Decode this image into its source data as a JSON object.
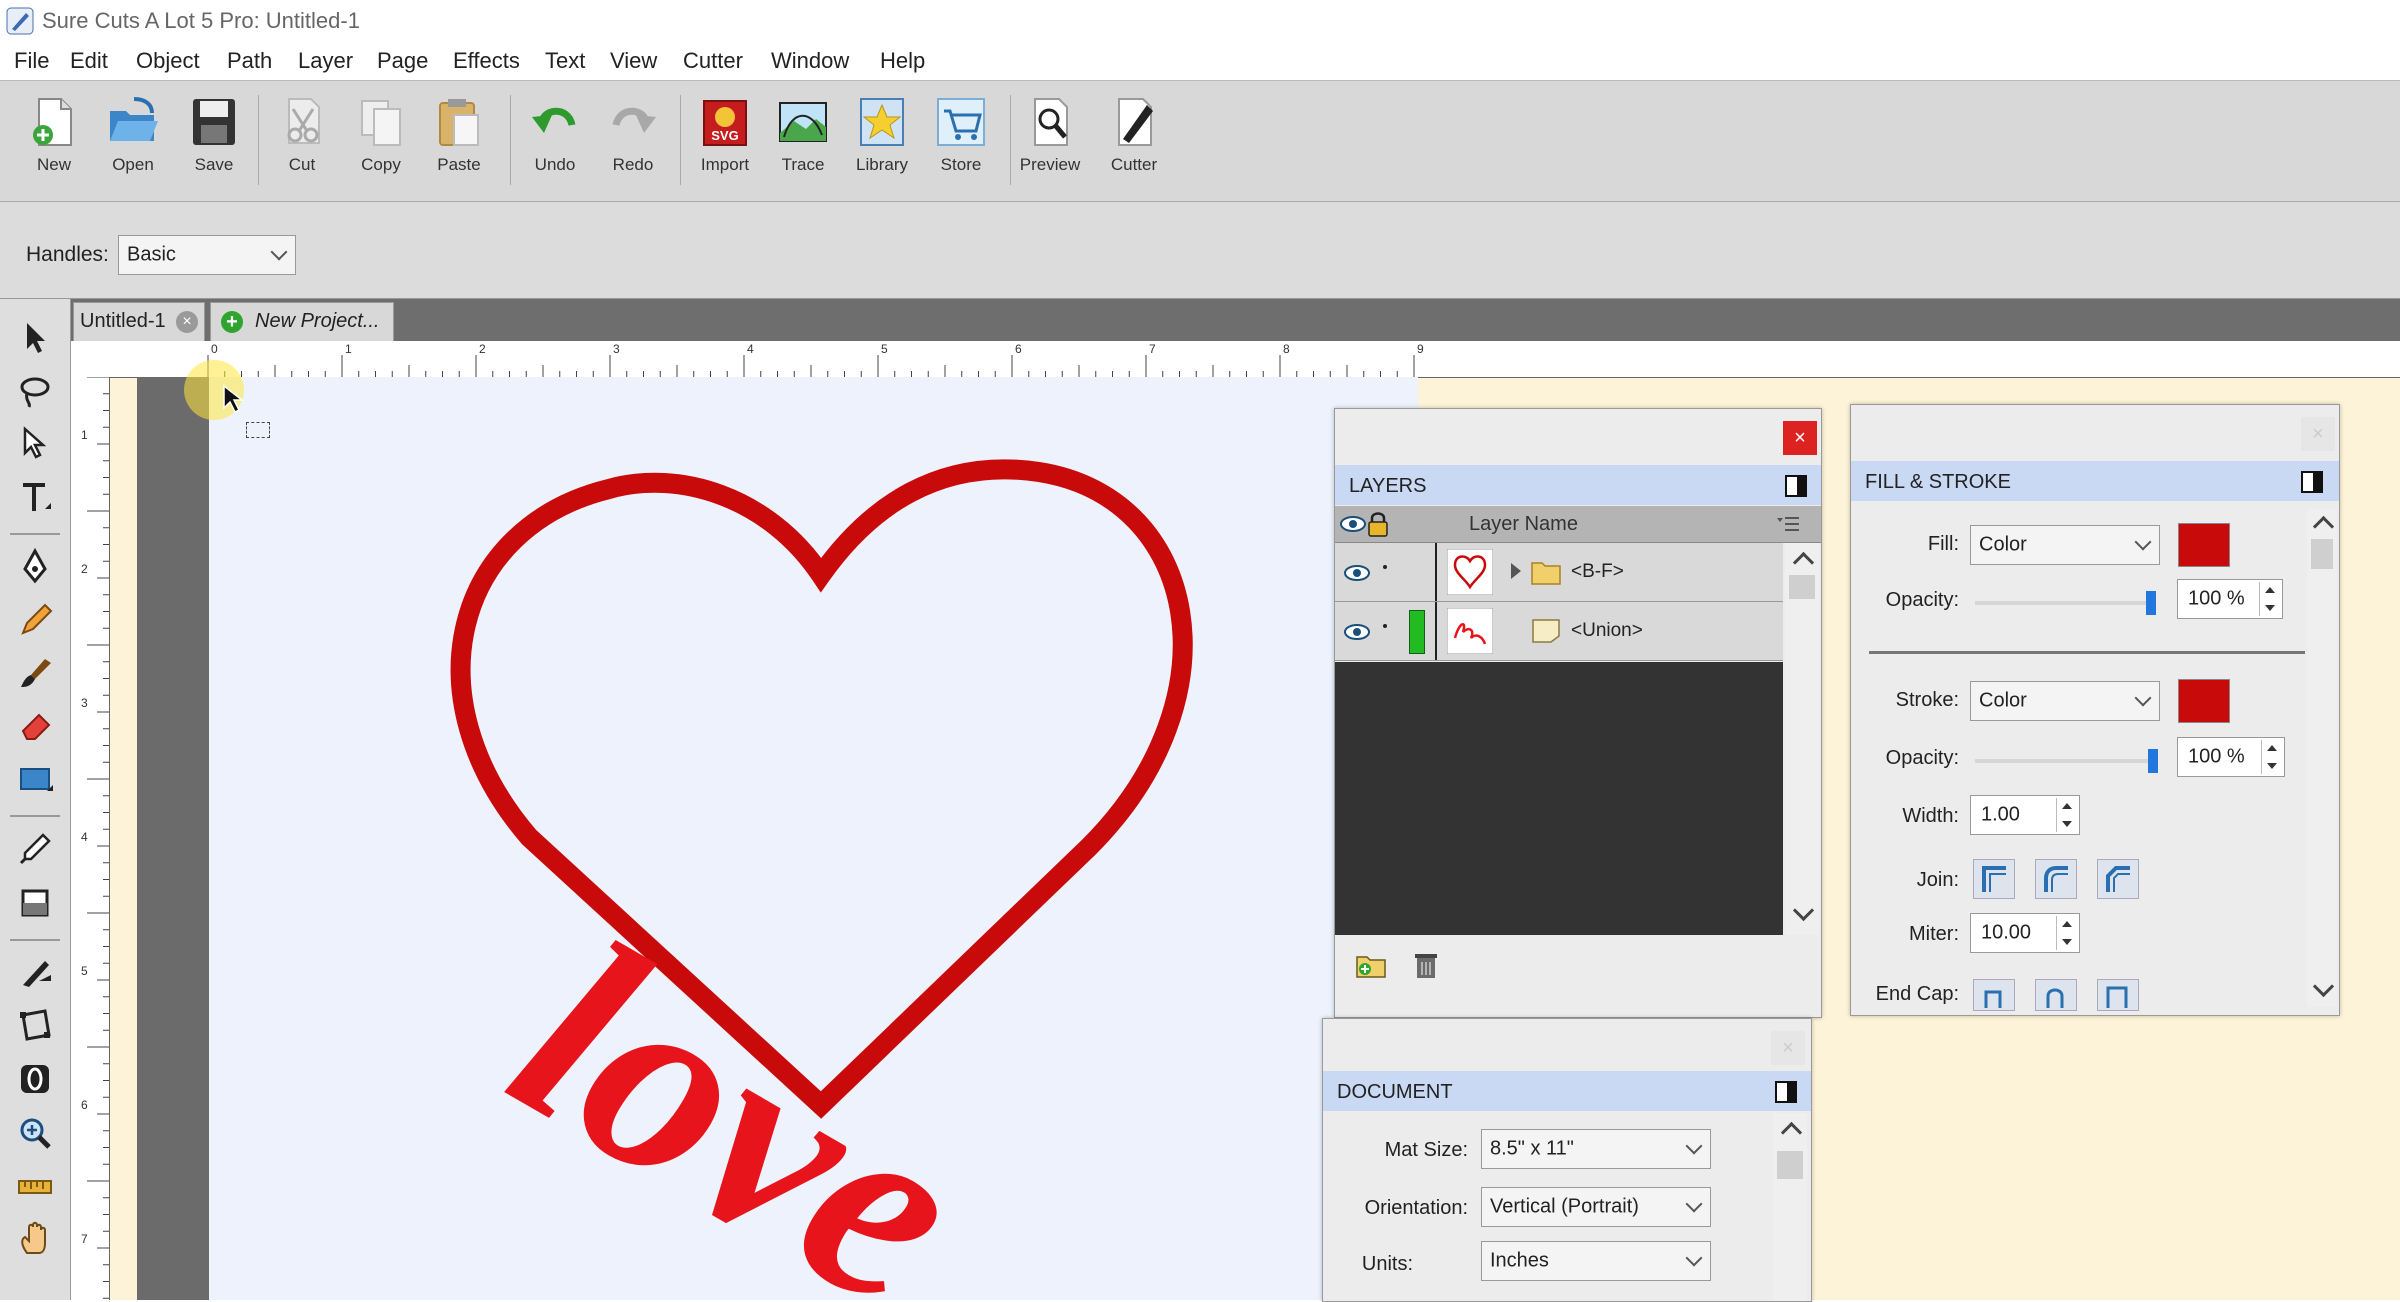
{
  "window": {
    "title": "Sure Cuts A Lot 5 Pro: Untitled-1"
  },
  "menu": [
    "File",
    "Edit",
    "Object",
    "Path",
    "Layer",
    "Page",
    "Effects",
    "Text",
    "View",
    "Cutter",
    "Window",
    "Help"
  ],
  "toolbar": {
    "new": "New",
    "open": "Open",
    "save": "Save",
    "cut": "Cut",
    "copy": "Copy",
    "paste": "Paste",
    "undo": "Undo",
    "redo": "Redo",
    "import": "Import",
    "trace": "Trace",
    "library": "Library",
    "store": "Store",
    "preview": "Preview",
    "cutter": "Cutter"
  },
  "options": {
    "handles_label": "Handles:",
    "handles_value": "Basic"
  },
  "tabs": {
    "current": "Untitled-1",
    "new_project": "New Project..."
  },
  "ruler": {
    "top": [
      "0",
      "1",
      "2",
      "3",
      "4",
      "5",
      "6",
      "7",
      "8",
      "9"
    ],
    "left": [
      "1",
      "2",
      "3",
      "4",
      "5",
      "6",
      "7"
    ]
  },
  "design": {
    "text": "love",
    "stroke_color": "#c90a0a",
    "text_color": "#e8141c"
  },
  "layers": {
    "title": "LAYERS",
    "column_header": "Layer Name",
    "rows": [
      {
        "name": "<B-F>",
        "type": "folder"
      },
      {
        "name": "<Union>",
        "type": "shape",
        "color": "#22bb22"
      }
    ],
    "close": "×"
  },
  "fill_stroke": {
    "title": "FILL & STROKE",
    "fill_label": "Fill:",
    "fill_type": "Color",
    "fill_color": "#c90a0a",
    "fill_opacity_label": "Opacity:",
    "fill_opacity": "100 %",
    "fill_opacity_level": 1.0,
    "stroke_label": "Stroke:",
    "stroke_type": "Color",
    "stroke_color": "#c90a0a",
    "stroke_opacity_label": "Opacity:",
    "stroke_opacity": "100 %",
    "stroke_opacity_level": 1.0,
    "width_label": "Width:",
    "width": "1.00",
    "join_label": "Join:",
    "miter_label": "Miter:",
    "miter": "10.00",
    "endcap_label": "End Cap:"
  },
  "document": {
    "title": "DOCUMENT",
    "mat_size_label": "Mat Size:",
    "mat_size": "8.5\" x 11\"",
    "orientation_label": "Orientation:",
    "orientation": "Vertical (Portrait)",
    "units_label": "Units:",
    "units": "Inches"
  }
}
